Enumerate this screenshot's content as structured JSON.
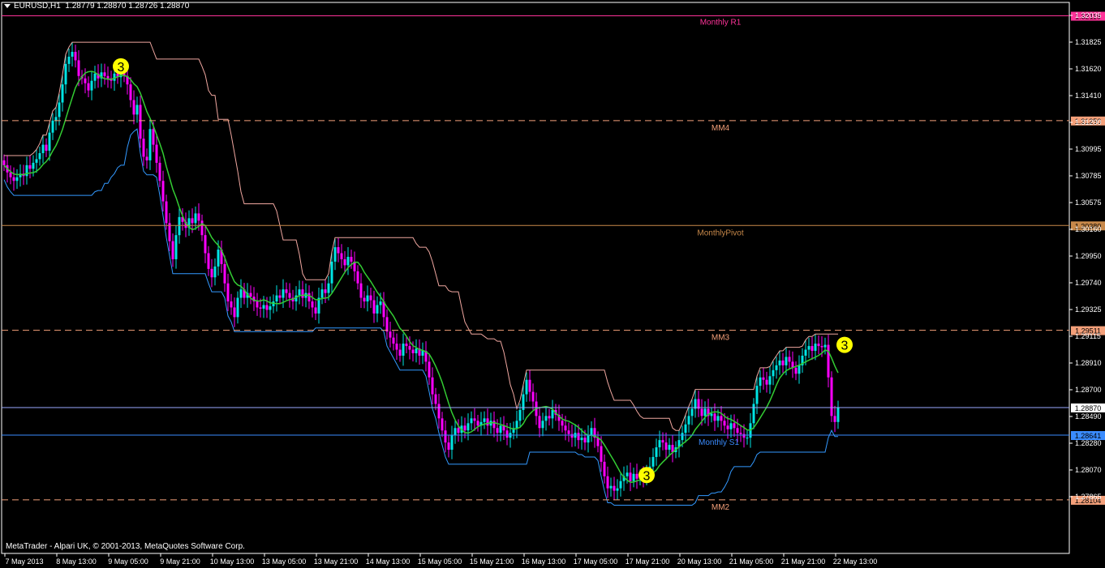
{
  "header": {
    "symbol": "EURUSD,H1",
    "ohlc": "1.28779 1.28870 1.28726 1.28870"
  },
  "footer": {
    "copyright": "MetaTrader - Alpari UK, © 2001-2013, MetaQuotes Software Corp."
  },
  "colors": {
    "background": "#000000",
    "frame": "#ffffff",
    "bull": "#00e5e5",
    "bear": "#ff00ff",
    "ma": "#33cc33",
    "resistance_step": "#f0a7a0",
    "support_step": "#3399ff",
    "level_line": "#f4a07a",
    "pivot_line": "#c8894a",
    "r1_line": "#ff3399",
    "bid_line": "#9aa8ff",
    "s1_line": "#3a8cff",
    "marker": "#ffff00"
  },
  "chart_data": {
    "type": "candlestick",
    "title": "EURUSD,H1",
    "ylim": [
      1.2766,
      1.3223
    ],
    "y_ticks": [
      "1.32035",
      "1.31825",
      "1.31620",
      "1.31410",
      "1.31200",
      "1.30995",
      "1.30785",
      "1.30575",
      "1.30160",
      "1.29950",
      "1.29740",
      "1.29325",
      "1.29115",
      "1.28910",
      "1.28700",
      "1.28490",
      "1.28280",
      "1.28070",
      "1.27865"
    ],
    "x_ticks": [
      "7 May 2013",
      "8 May 13:00",
      "9 May 05:00",
      "9 May 21:00",
      "10 May 13:00",
      "13 May 05:00",
      "13 May 21:00",
      "14 May 13:00",
      "15 May 05:00",
      "15 May 21:00",
      "16 May 13:00",
      "17 May 05:00",
      "17 May 21:00",
      "20 May 13:00",
      "21 May 05:00",
      "21 May 21:00",
      "22 May 13:00"
    ],
    "levels": [
      {
        "label": "Monthly R1",
        "value": "1.32119",
        "price": 1.32119,
        "style": "solid",
        "color": "#ff3399",
        "side": "top"
      },
      {
        "label": "MM4",
        "value": "1.31250",
        "price": 1.3125,
        "style": "dashed",
        "color": "#f4a07a",
        "side": "bottom"
      },
      {
        "label": "MonthlyPivot",
        "value": "1.30380",
        "price": 1.3038,
        "style": "solid",
        "color": "#c8894a",
        "side": "bottom"
      },
      {
        "label": "MM3",
        "value": "1.29511",
        "price": 1.29511,
        "style": "dashed",
        "color": "#f4a07a",
        "side": "bottom"
      },
      {
        "label": "",
        "value": "1.28870",
        "price": 1.2887,
        "style": "solid",
        "color": "#9aa8ff",
        "side": "none"
      },
      {
        "label": "Monthly S1",
        "value": "1.28641",
        "price": 1.28641,
        "style": "solid",
        "color": "#3a8cff",
        "side": "bottom"
      },
      {
        "label": "MM2",
        "value": "1.28104",
        "price": 1.28104,
        "style": "dashed",
        "color": "#f4a07a",
        "side": "bottom"
      }
    ],
    "markers": [
      {
        "label": "3",
        "bar": 36,
        "price": 1.317
      },
      {
        "label": "3",
        "bar": 198,
        "price": 1.2831
      },
      {
        "label": "3",
        "bar": 259,
        "price": 1.2939
      }
    ],
    "bar_count": 262,
    "closes": [
      1.3088,
      1.3082,
      1.3078,
      1.3075,
      1.3078,
      1.3081,
      1.3079,
      1.3088,
      1.3085,
      1.309,
      1.3093,
      1.3098,
      1.3105,
      1.31,
      1.3115,
      1.3125,
      1.3128,
      1.314,
      1.3155,
      1.3172,
      1.3178,
      1.3182,
      1.3175,
      1.3162,
      1.316,
      1.3156,
      1.315,
      1.3158,
      1.3164,
      1.316,
      1.3165,
      1.3162,
      1.316,
      1.3158,
      1.3164,
      1.3161,
      1.3168,
      1.3162,
      1.3155,
      1.3142,
      1.313,
      1.3138,
      1.311,
      1.3095,
      1.3092,
      1.3118,
      1.3105,
      1.309,
      1.3075,
      1.3058,
      1.304,
      1.3025,
      1.301,
      1.303,
      1.3045,
      1.3041,
      1.3036,
      1.3044,
      1.304,
      1.3048,
      1.3042,
      1.303,
      1.3015,
      1.3002,
      1.2995,
      1.3004,
      1.3018,
      1.3006,
      1.299,
      1.2975,
      1.297,
      1.2962,
      1.2978,
      1.2985,
      1.2978,
      1.2982,
      1.2979,
      1.2975,
      1.297,
      1.2969,
      1.2972,
      1.2968,
      1.2971,
      1.2975,
      1.298,
      1.2978,
      1.2985,
      1.2982,
      1.2978,
      1.2975,
      1.298,
      1.2985,
      1.2978,
      1.2982,
      1.2975,
      1.297,
      1.2965,
      1.2978,
      1.2985,
      1.2982,
      1.299,
      1.3008,
      1.302,
      1.3015,
      1.301,
      1.3005,
      1.3012,
      1.3008,
      1.3,
      1.299,
      1.2978,
      1.2975,
      1.298,
      1.2976,
      1.2965,
      1.2972,
      1.2975,
      1.2962,
      1.295,
      1.2945,
      1.294,
      1.2935,
      1.293,
      1.294,
      1.2938,
      1.2935,
      1.2932,
      1.2936,
      1.293,
      1.2934,
      1.2925,
      1.2912,
      1.2898,
      1.289,
      1.2878,
      1.2868,
      1.2858,
      1.2852,
      1.2864,
      1.287,
      1.2866,
      1.2872,
      1.2868,
      1.2874,
      1.2878,
      1.2876,
      1.2872,
      1.2875,
      1.2878,
      1.2872,
      1.2876,
      1.287,
      1.2866,
      1.2872,
      1.2868,
      1.2862,
      1.2866,
      1.287,
      1.2876,
      1.2885,
      1.2898,
      1.291,
      1.29,
      1.2892,
      1.288,
      1.287,
      1.2876,
      1.288,
      1.2878,
      1.2885,
      1.2881,
      1.2876,
      1.2872,
      1.2868,
      1.2865,
      1.2862,
      1.2866,
      1.286,
      1.2862,
      1.2858,
      1.2864,
      1.287,
      1.2862,
      1.2855,
      1.2842,
      1.283,
      1.282,
      1.2822,
      1.2818,
      1.282,
      1.2826,
      1.283,
      1.2833,
      1.2826,
      1.2832,
      1.2828,
      1.283,
      1.2829,
      1.2833,
      1.2838,
      1.2846,
      1.2854,
      1.286,
      1.2858,
      1.2852,
      1.2856,
      1.285,
      1.2854,
      1.286,
      1.2866,
      1.2873,
      1.288,
      1.2886,
      1.2894,
      1.2886,
      1.288,
      1.2886,
      1.288,
      1.2882,
      1.2876,
      1.288,
      1.2876,
      1.2872,
      1.2869,
      1.2874,
      1.287,
      1.2866,
      1.2865,
      1.2862,
      1.2862,
      1.2874,
      1.289,
      1.2905,
      1.2912,
      1.291,
      1.2906,
      1.2913,
      1.2918,
      1.2922,
      1.2926,
      1.2922,
      1.2929,
      1.2925,
      1.292,
      1.2915,
      1.2922,
      1.293,
      1.2935,
      1.2938,
      1.2934,
      1.294,
      1.2938,
      1.2937,
      1.2939,
      1.2912,
      1.288,
      1.2875,
      1.2887
    ]
  }
}
